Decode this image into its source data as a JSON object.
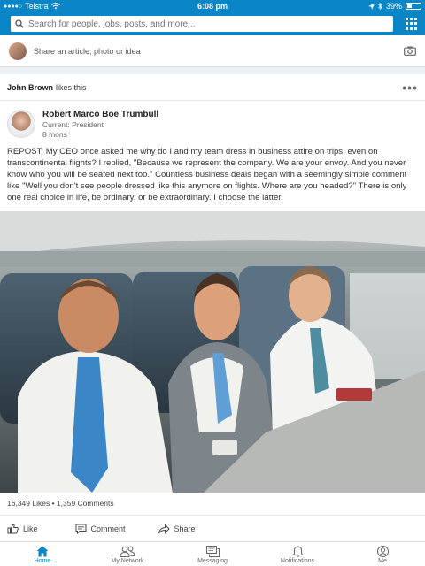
{
  "status_bar": {
    "carrier": "Telstra",
    "time": "6:08 pm",
    "battery": "39%",
    "battery_level": 0.39
  },
  "search": {
    "placeholder": "Search for people, jobs, posts, and more..."
  },
  "share": {
    "prompt": "Share an article, photo or idea"
  },
  "post": {
    "liker_name": "John Brown",
    "liker_action": "likes this",
    "author_name": "Robert Marco Boe Trumbull",
    "author_title": "Current: President",
    "author_time": "8 mons",
    "text": "REPOST: My CEO once asked me why do I and my team dress in business attire on trips, even on transcontinental flights? I replied, \"Because we represent the company. We are your envoy. And you never know who you will be seated next too.\" Countless business deals began with a seemingly simple comment like \"Well you don't see people dressed like this anymore on flights. Where are you headed?\" There is only one real choice in life, be ordinary, or be extraordinary. I choose the latter.",
    "stats": "16,349 Likes • 1,359 Comments",
    "actions": {
      "like": "Like",
      "comment": "Comment",
      "share": "Share"
    }
  },
  "nav": {
    "items": [
      {
        "label": "Home",
        "icon": "home-icon"
      },
      {
        "label": "My Network",
        "icon": "network-icon"
      },
      {
        "label": "Messaging",
        "icon": "messaging-icon"
      },
      {
        "label": "Notifications",
        "icon": "bell-icon"
      },
      {
        "label": "Me",
        "icon": "profile-icon"
      }
    ]
  },
  "colors": {
    "brand": "#0a86c6",
    "active_nav": "#0a86c6"
  }
}
